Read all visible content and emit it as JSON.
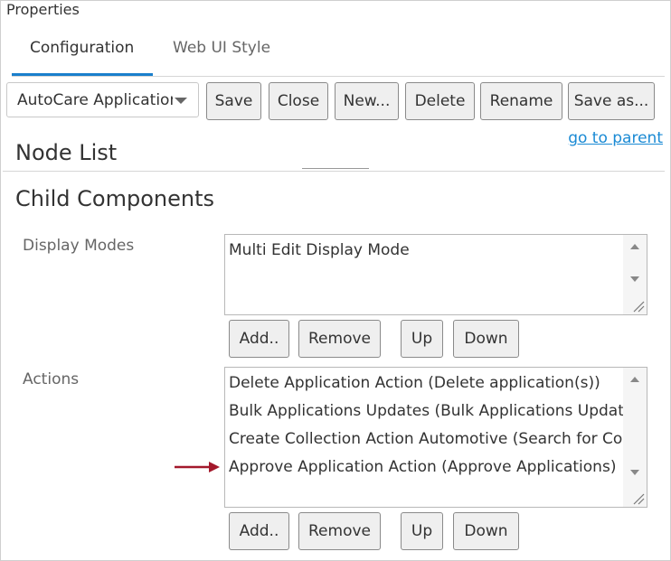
{
  "window": {
    "title": "Properties"
  },
  "tabs": [
    {
      "label": "Configuration",
      "active": true
    },
    {
      "label": "Web UI Style",
      "active": false
    }
  ],
  "toolbar": {
    "dropdown_value": "AutoCare Application",
    "buttons": {
      "save": "Save",
      "close": "Close",
      "new": "New...",
      "delete": "Delete",
      "rename": "Rename",
      "save_as": "Save as..."
    }
  },
  "links": {
    "go_to_parent": "go to parent"
  },
  "node_list": {
    "title": "Node List"
  },
  "child_components": {
    "title": "Child Components",
    "display_modes": {
      "label": "Display Modes",
      "items": [
        "Multi Edit Display Mode"
      ],
      "buttons": {
        "add": "Add..",
        "remove": "Remove",
        "up": "Up",
        "down": "Down"
      }
    },
    "actions": {
      "label": "Actions",
      "items": [
        "Delete Application Action (Delete application(s))",
        "Bulk Applications Updates (Bulk Applications Updates)",
        "Create Collection Action Automotive (Search for Collections)",
        "Approve Application Action (Approve Applications)"
      ],
      "highlight_index": 3,
      "buttons": {
        "add": "Add..",
        "remove": "Remove",
        "up": "Up",
        "down": "Down"
      }
    }
  },
  "colors": {
    "accent": "#1a7fcc",
    "link": "#1a8ad4",
    "annotation_arrow": "#a3182b"
  },
  "icons": {
    "dropdown": "chevron-down-icon",
    "annotation": "right-arrow-icon"
  }
}
